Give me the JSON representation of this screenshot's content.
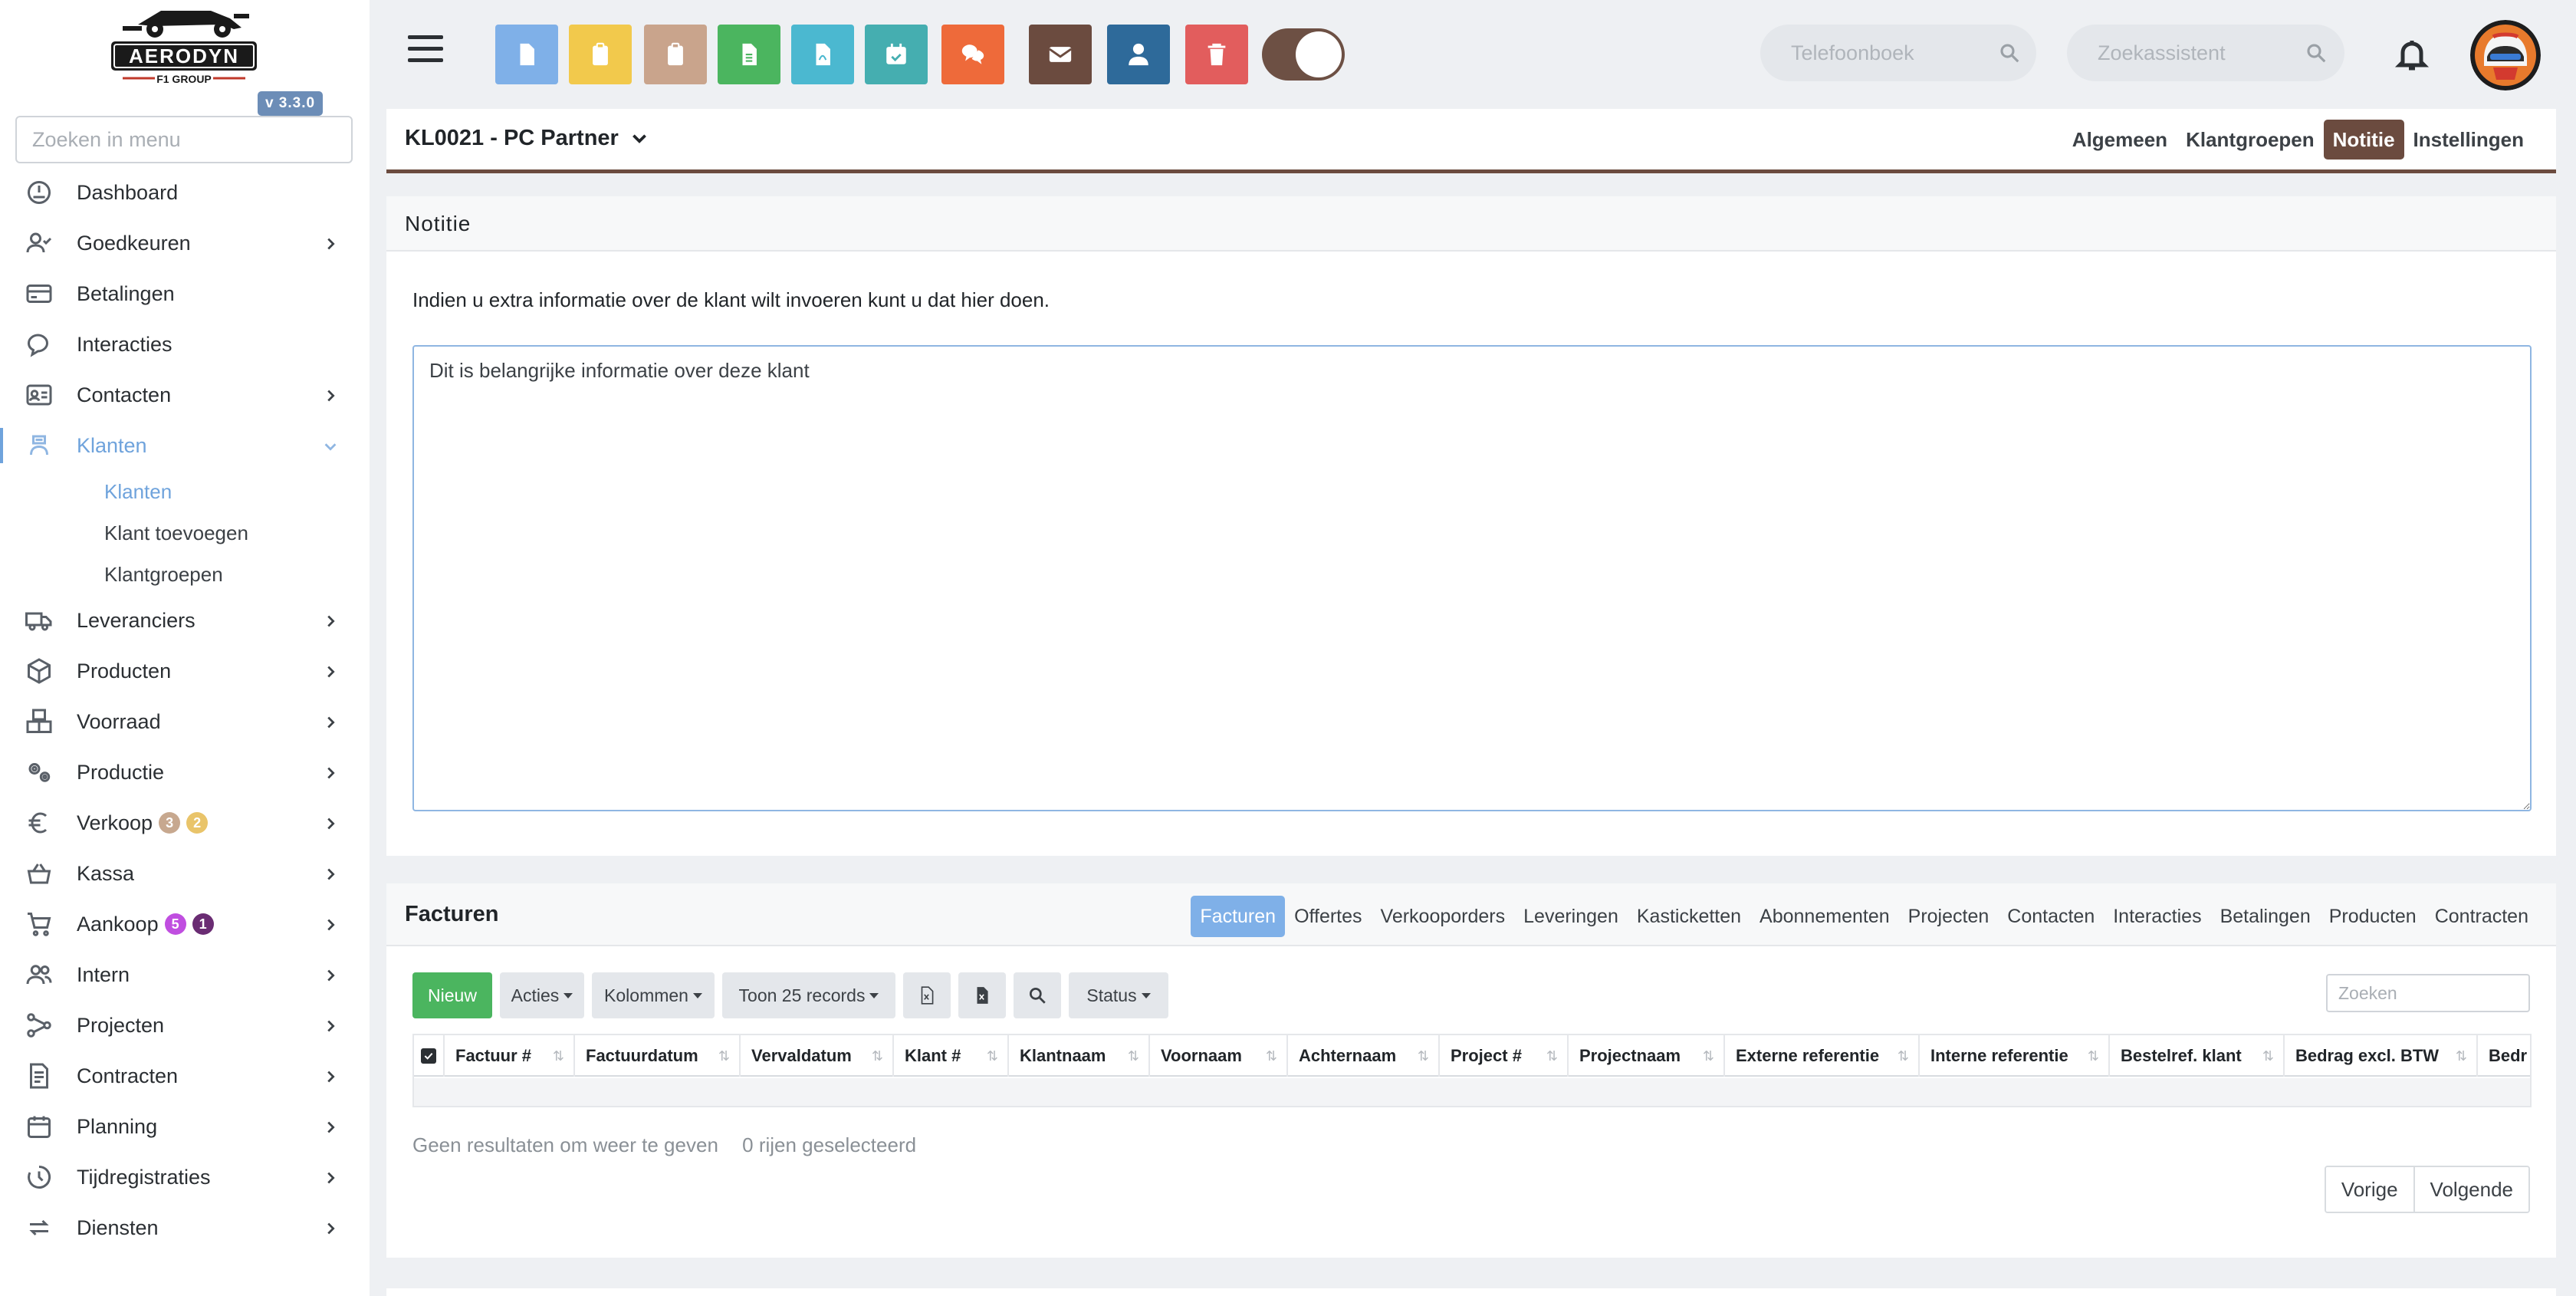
{
  "app": {
    "logo_text": "AERODYN",
    "logo_subtext": "F1 GROUP",
    "version": "v 3.3.0"
  },
  "sidebar": {
    "search_placeholder": "Zoeken in menu",
    "items": [
      {
        "label": "Dashboard",
        "icon": "dashboard-icon",
        "has_chevron": false
      },
      {
        "label": "Goedkeuren",
        "icon": "user-check-icon",
        "has_chevron": true
      },
      {
        "label": "Betalingen",
        "icon": "credit-card-icon",
        "has_chevron": false
      },
      {
        "label": "Interacties",
        "icon": "chat-icon",
        "has_chevron": false
      },
      {
        "label": "Contacten",
        "icon": "contact-card-icon",
        "has_chevron": true
      },
      {
        "label": "Klanten",
        "icon": "customer-icon",
        "has_chevron": true,
        "active": true
      },
      {
        "label": "Leveranciers",
        "icon": "truck-icon",
        "has_chevron": true
      },
      {
        "label": "Producten",
        "icon": "box-icon",
        "has_chevron": true
      },
      {
        "label": "Voorraad",
        "icon": "boxes-icon",
        "has_chevron": true
      },
      {
        "label": "Productie",
        "icon": "gears-icon",
        "has_chevron": true
      },
      {
        "label": "Verkoop",
        "icon": "euro-icon",
        "has_chevron": true,
        "badges": [
          "3",
          "2"
        ]
      },
      {
        "label": "Kassa",
        "icon": "basket-icon",
        "has_chevron": true
      },
      {
        "label": "Aankoop",
        "icon": "cart-icon",
        "has_chevron": true,
        "badges": [
          "5",
          "1"
        ]
      },
      {
        "label": "Intern",
        "icon": "users-icon",
        "has_chevron": true
      },
      {
        "label": "Projecten",
        "icon": "sitemap-icon",
        "has_chevron": true
      },
      {
        "label": "Contracten",
        "icon": "contract-icon",
        "has_chevron": true
      },
      {
        "label": "Planning",
        "icon": "calendar-icon",
        "has_chevron": true
      },
      {
        "label": "Tijdregistraties",
        "icon": "timer-icon",
        "has_chevron": true
      },
      {
        "label": "Diensten",
        "icon": "refresh-icon",
        "has_chevron": true
      }
    ],
    "klanten_sub": [
      "Klanten",
      "Klant toevoegen",
      "Klantgroepen"
    ],
    "badge_colors": {
      "verkoop": [
        "#c7a88f",
        "#e9c46a"
      ],
      "aankoop": [
        "#c04ee0",
        "#6a2c73"
      ]
    }
  },
  "topbar": {
    "buttons": [
      {
        "icon": "document-icon",
        "color": "#7fb0e8"
      },
      {
        "icon": "clipboard-icon",
        "color": "#f2c94c"
      },
      {
        "icon": "clipboard-icon",
        "color": "#c9a48c"
      },
      {
        "icon": "spreadsheet-icon",
        "color": "#4bb55f"
      },
      {
        "icon": "pdf-icon",
        "color": "#4bb8d0"
      },
      {
        "icon": "calendar-check-icon",
        "color": "#45aeb0"
      },
      {
        "icon": "comments-icon",
        "color": "#ee6a3a"
      },
      {
        "icon": "envelope-icon",
        "color": "#6b4b3f"
      },
      {
        "icon": "user-icon",
        "color": "#2e6a9a"
      },
      {
        "icon": "trash-icon",
        "color": "#e25d5d"
      }
    ],
    "phonebook_placeholder": "Telefoonboek",
    "assistant_placeholder": "Zoekassistent"
  },
  "header": {
    "title": "KL0021 - PC Partner",
    "tabs": [
      "Algemeen",
      "Klantgroepen",
      "Notitie",
      "Instellingen"
    ],
    "active_tab": "Notitie",
    "accent_color": "#6b4b3f"
  },
  "note": {
    "title": "Notitie",
    "description": "Indien u extra informatie over de klant wilt invoeren kunt u dat hier doen.",
    "text": "Dit is belangrijke informatie over deze klant"
  },
  "invoices": {
    "title": "Facturen",
    "tabs": [
      "Facturen",
      "Offertes",
      "Verkooporders",
      "Leveringen",
      "Kasticketten",
      "Abonnementen",
      "Projecten",
      "Contacten",
      "Interacties",
      "Betalingen",
      "Producten",
      "Contracten"
    ],
    "active_tab": "Facturen",
    "toolbar": {
      "new": "Nieuw",
      "actions": "Acties",
      "columns": "Kolommen",
      "show": "Toon 25 records",
      "status": "Status"
    },
    "search_placeholder": "Zoeken",
    "columns": [
      "Factuur #",
      "Factuurdatum",
      "Vervaldatum",
      "Klant #",
      "Klantnaam",
      "Voornaam",
      "Achternaam",
      "Project #",
      "Projectnaam",
      "Externe referentie",
      "Interne referentie",
      "Bestelref. klant",
      "Bedrag excl. BTW",
      "Bedr"
    ],
    "empty_text": "Geen resultaten om weer te geven",
    "selected_text": "0 rijen geselecteerd",
    "prev": "Vorige",
    "next": "Volgende"
  }
}
